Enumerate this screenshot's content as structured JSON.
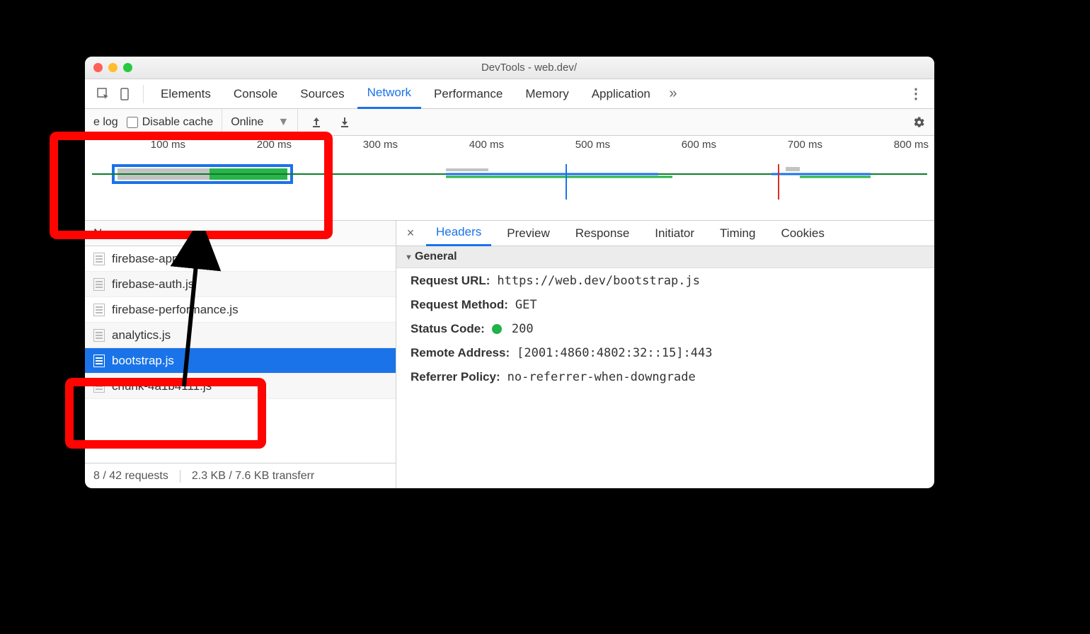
{
  "window": {
    "title": "DevTools - web.dev/"
  },
  "mainTabs": [
    "Elements",
    "Console",
    "Sources",
    "Network",
    "Performance",
    "Memory",
    "Application"
  ],
  "mainTabActive": "Network",
  "toolbar": {
    "preserveLog": "e log",
    "disableCache": "Disable cache",
    "throttling": "Online"
  },
  "timeline": {
    "ticks": [
      "100 ms",
      "200 ms",
      "300 ms",
      "400 ms",
      "500 ms",
      "600 ms",
      "700 ms",
      "800 ms"
    ]
  },
  "nameHeader": "Name",
  "requests": [
    {
      "name": "firebase-app.js",
      "selected": false
    },
    {
      "name": "firebase-auth.js",
      "selected": false
    },
    {
      "name": "firebase-performance.js",
      "selected": false
    },
    {
      "name": "analytics.js",
      "selected": false
    },
    {
      "name": "bootstrap.js",
      "selected": true
    },
    {
      "name": "chunk-4a1b4111.js",
      "selected": false
    }
  ],
  "statusBar": {
    "requests": "8 / 42 requests",
    "transferred": "2.3 KB / 7.6 KB transferr"
  },
  "detailTabs": [
    "Headers",
    "Preview",
    "Response",
    "Initiator",
    "Timing",
    "Cookies"
  ],
  "detailTabActive": "Headers",
  "general": {
    "section": "General",
    "url_k": "Request URL:",
    "url_v": "https://web.dev/bootstrap.js",
    "method_k": "Request Method:",
    "method_v": "GET",
    "status_k": "Status Code:",
    "status_v": "200",
    "remote_k": "Remote Address:",
    "remote_v": "[2001:4860:4802:32::15]:443",
    "refpol_k": "Referrer Policy:",
    "refpol_v": "no-referrer-when-downgrade"
  }
}
